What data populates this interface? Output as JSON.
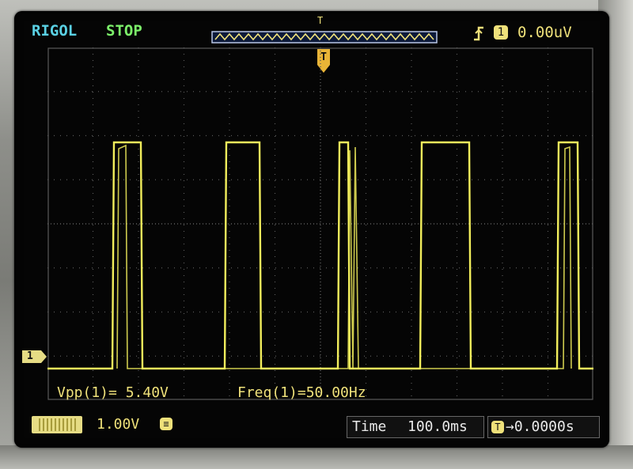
{
  "header": {
    "brand": "RIGOL",
    "run_state": "STOP",
    "trigger_marker": "T",
    "trigger_channel": "1",
    "trigger_level": "0.00uV"
  },
  "waveform": {
    "channel": "1",
    "trigger_offset_marker": "T",
    "color": "#f2ee5c"
  },
  "measurements": {
    "vpp": "Vpp(1)= 5.40V",
    "freq": "Freq(1)=50.00Hz"
  },
  "status_bar": {
    "ch1_scale": "1.00V",
    "ch1_coupling_symbol": "≡",
    "timebase_label": "Time",
    "timebase_value": "100.0ms",
    "trigger_position_marker": "T",
    "trigger_position": "→0.0000s"
  },
  "colors": {
    "trace": "#f2ee5c",
    "brand": "#5ad1e4",
    "run_state": "#7cf06a",
    "grid": "#5a5a5a"
  }
}
